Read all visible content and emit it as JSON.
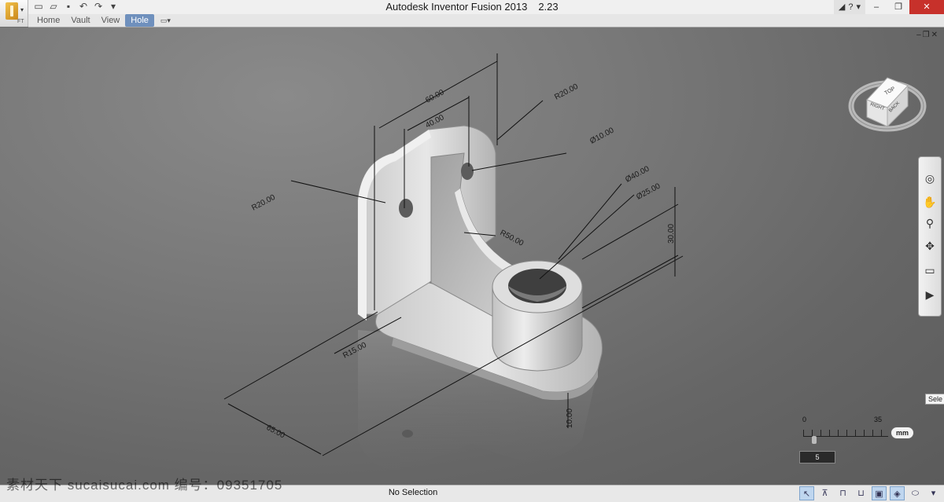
{
  "window": {
    "title": "Autodesk Inventor Fusion 2013",
    "version": "2.23",
    "app_menu_sub": "FT",
    "controls": [
      "minimize-icon",
      "maximize-icon",
      "close-icon"
    ]
  },
  "quick_access": [
    "new-icon",
    "open-icon",
    "save-icon",
    "undo-icon",
    "redo-icon",
    "customize-icon"
  ],
  "tabs": [
    {
      "label": "Home",
      "active": false
    },
    {
      "label": "Vault",
      "active": false
    },
    {
      "label": "View",
      "active": false
    },
    {
      "label": "Hole",
      "active": true
    }
  ],
  "dimensions": {
    "d60": "60.00",
    "d40": "40.00",
    "r20_top": "R20.00",
    "dia10": "Ø10.00",
    "r20_left": "R20.00",
    "dia40": "Ø40.00",
    "dia25": "Ø25.00",
    "h30": "30.00",
    "r50": "R50.00",
    "r15": "R15.00",
    "d65": "65.00",
    "t10": "10.00"
  },
  "viewcube": {
    "faces": [
      "TOP",
      "RIGHT",
      "BACK"
    ]
  },
  "navbar": {
    "tools": [
      "steering-wheel-icon",
      "pan-icon",
      "zoom-icon",
      "orbit-icon",
      "look-at-icon",
      "show-motion-icon"
    ]
  },
  "tooltip": "Sele",
  "scale": {
    "min": "0",
    "max": "35",
    "unit": "mm",
    "value": "5"
  },
  "status": {
    "text": "No Selection"
  },
  "watermark": "素材天下 sucaisucai.com   编号：09351705",
  "accent": "#6f90bd"
}
